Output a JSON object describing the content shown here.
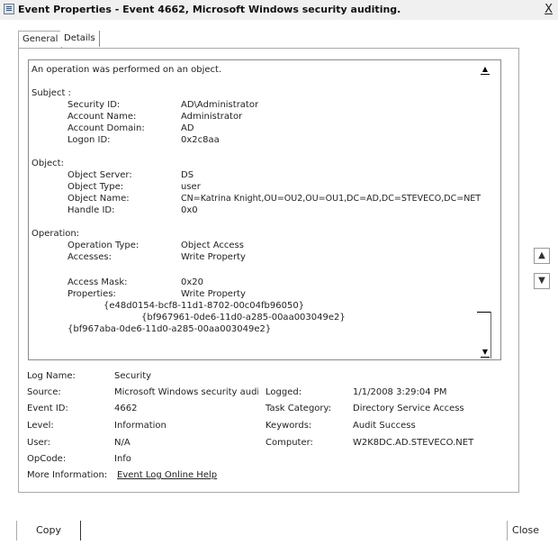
{
  "window": {
    "title": "Event Properties - Event 4662, Microsoft Windows security auditing.",
    "close_label": "X"
  },
  "tabs": [
    {
      "label": "General"
    },
    {
      "label": "Details"
    }
  ],
  "description": {
    "intro": "An operation was performed on an object.",
    "subject_heading": "Subject :",
    "subject": {
      "security_id_label": "Security ID:",
      "security_id": "AD\\Administrator",
      "account_name_label": "Account Name:",
      "account_name": "Administrator",
      "account_domain_label": "Account Domain:",
      "account_domain": "AD",
      "logon_id_label": "Logon ID:",
      "logon_id": "0x2c8aa"
    },
    "object_heading": "Object:",
    "object": {
      "server_label": "Object Server:",
      "server": "DS",
      "type_label": "Object Type:",
      "type": "user",
      "name_label": "Object Name:",
      "name": "CN=Katrina Knight,OU=OU2,OU=OU1,DC=AD,DC=STEVECO,DC=NET",
      "handle_label": "Handle ID:",
      "handle": "0x0"
    },
    "operation_heading": "Operation:",
    "operation": {
      "type_label": "Operation Type:",
      "type": "Object Access",
      "accesses_label": "Accesses:",
      "accesses": "Write Property",
      "mask_label": "Access Mask:",
      "mask": "0x20",
      "properties_label": "Properties:",
      "properties": "Write Property",
      "guid1": "{e48d0154-bcf8-11d1-8702-00c04fb96050}",
      "guid2": "{bf967961-0de6-11d0-a285-00aa003049e2}",
      "guid3": "{bf967aba-0de6-11d0-a285-00aa003049e2}"
    }
  },
  "fields": {
    "log_name_label": "Log Name:",
    "log_name": "Security",
    "source_label": "Source:",
    "source": "Microsoft Windows security auditii",
    "logged_label": "Logged:",
    "logged": "1/1/2008 3:29:04 PM",
    "event_id_label": "Event ID:",
    "event_id": "4662",
    "task_category_label": "Task Category:",
    "task_category": "Directory Service Access",
    "level_label": "Level:",
    "level": "Information",
    "keywords_label": "Keywords:",
    "keywords": "Audit Success",
    "user_label": "User:",
    "user": "N/A",
    "computer_label": "Computer:",
    "computer": "W2K8DC.AD.STEVECO.NET",
    "opcode_label": "OpCode:",
    "opcode": "Info",
    "more_info_label": "More Information:",
    "more_info_link": "Event Log Online Help"
  },
  "buttons": {
    "copy": "Copy",
    "close": "Close"
  },
  "icons": {
    "window": "event-properties-icon",
    "up": "arrow-up-icon",
    "down": "arrow-down-icon"
  }
}
